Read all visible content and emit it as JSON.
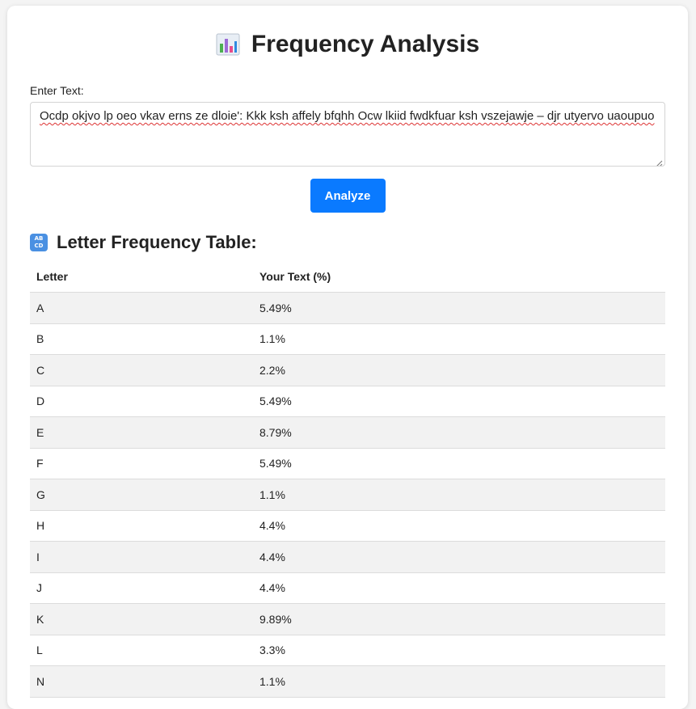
{
  "header": {
    "title": "Frequency Analysis",
    "icon": "bar-chart-icon"
  },
  "input": {
    "label": "Enter Text:",
    "value": "Ocdp okjvo lp oeo vkav erns ze dloie': Kkk ksh affely bfqhh Ocw lkiid fwdkfuar ksh vszejawje – djr utyervo uaoupuo"
  },
  "actions": {
    "analyze_label": "Analyze"
  },
  "table_section": {
    "heading": "Letter Frequency Table:",
    "icon": "abcd-icon",
    "columns": [
      "Letter",
      "Your Text (%)"
    ],
    "rows": [
      {
        "letter": "A",
        "pct": "5.49%"
      },
      {
        "letter": "B",
        "pct": "1.1%"
      },
      {
        "letter": "C",
        "pct": "2.2%"
      },
      {
        "letter": "D",
        "pct": "5.49%"
      },
      {
        "letter": "E",
        "pct": "8.79%"
      },
      {
        "letter": "F",
        "pct": "5.49%"
      },
      {
        "letter": "G",
        "pct": "1.1%"
      },
      {
        "letter": "H",
        "pct": "4.4%"
      },
      {
        "letter": "I",
        "pct": "4.4%"
      },
      {
        "letter": "J",
        "pct": "4.4%"
      },
      {
        "letter": "K",
        "pct": "9.89%"
      },
      {
        "letter": "L",
        "pct": "3.3%"
      },
      {
        "letter": "N",
        "pct": "1.1%"
      }
    ]
  },
  "colors": {
    "accent": "#0a7aff",
    "row_stripe": "#f2f2f2"
  }
}
